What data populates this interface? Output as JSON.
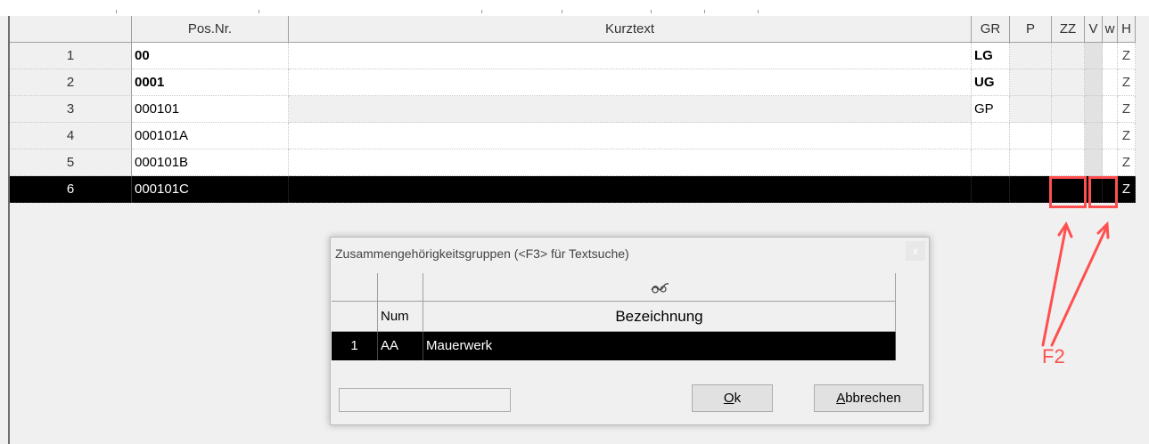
{
  "grid": {
    "headers": {
      "pos": "Pos.Nr.",
      "kurztext": "Kurztext",
      "gr": "GR",
      "p": "P",
      "zz": "ZZ",
      "v": "V",
      "w": "w",
      "h": "H"
    },
    "rows": [
      {
        "num": "1",
        "pos": "00",
        "kurztext": "",
        "gr": "LG",
        "h": "Z"
      },
      {
        "num": "2",
        "pos": "0001",
        "kurztext": "",
        "gr": "UG",
        "h": "Z"
      },
      {
        "num": "3",
        "pos": "000101",
        "kurztext": "",
        "gr": "GP",
        "h": "Z"
      },
      {
        "num": "4",
        "pos": "000101A",
        "kurztext": "",
        "gr": "",
        "h": "Z"
      },
      {
        "num": "5",
        "pos": "000101B",
        "kurztext": "",
        "gr": "",
        "h": "Z"
      },
      {
        "num": "6",
        "pos": "000101C",
        "kurztext": "",
        "gr": "",
        "h": "Z"
      }
    ],
    "selected_row": "6"
  },
  "annotation": {
    "label": "F2",
    "color": "#ff4f4f"
  },
  "dialog": {
    "title": "Zusammengehörigkeitsgruppen  (<F3> für Textsuche)",
    "close": "x",
    "columns": {
      "num": "Num",
      "bezeichnung": "Bezeichnung",
      "icon": "glasses-icon"
    },
    "rows": [
      {
        "index": "1",
        "num": "AA",
        "bezeichnung": "Mauerwerk"
      }
    ],
    "search_value": "",
    "ok": {
      "mnemonic": "O",
      "rest": "k"
    },
    "cancel": {
      "mnemonic": "A",
      "rest": "bbrechen"
    }
  }
}
